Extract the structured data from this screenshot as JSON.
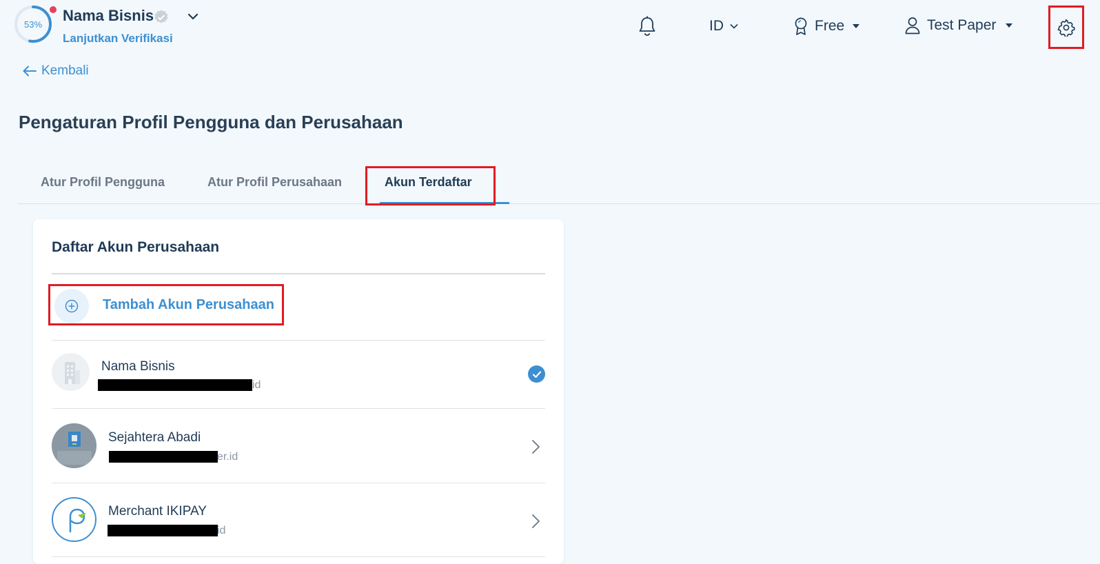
{
  "header": {
    "progress_percent": 53,
    "progress_label": "53%",
    "business_name": "Nama Bisnis",
    "verify_link": "Lanjutkan Verifikasi",
    "language": "ID",
    "plan": "Free",
    "user_name": "Test Paper"
  },
  "nav": {
    "back_label": "Kembali"
  },
  "page": {
    "title": "Pengaturan Profil Pengguna dan Perusahaan",
    "tabs": [
      {
        "label": "Atur Profil Pengguna",
        "active": false
      },
      {
        "label": "Atur Profil Perusahaan",
        "active": false
      },
      {
        "label": "Akun Terdaftar",
        "active": true
      }
    ]
  },
  "card": {
    "title": "Daftar Akun Perusahaan",
    "add_label": "Tambah Akun Perusahaan",
    "accounts": [
      {
        "name": "Nama Bisnis",
        "email_tail": "id",
        "selected": true
      },
      {
        "name": "Sejahtera Abadi",
        "email_tail": "er.id",
        "selected": false
      },
      {
        "name": "Merchant IKIPAY",
        "email_tail": "id",
        "selected": false
      }
    ]
  },
  "colors": {
    "accent": "#3d8fd1",
    "highlight_box": "#e01b24",
    "notification_dot": "#e4415f",
    "background": "#f2f8fc"
  }
}
